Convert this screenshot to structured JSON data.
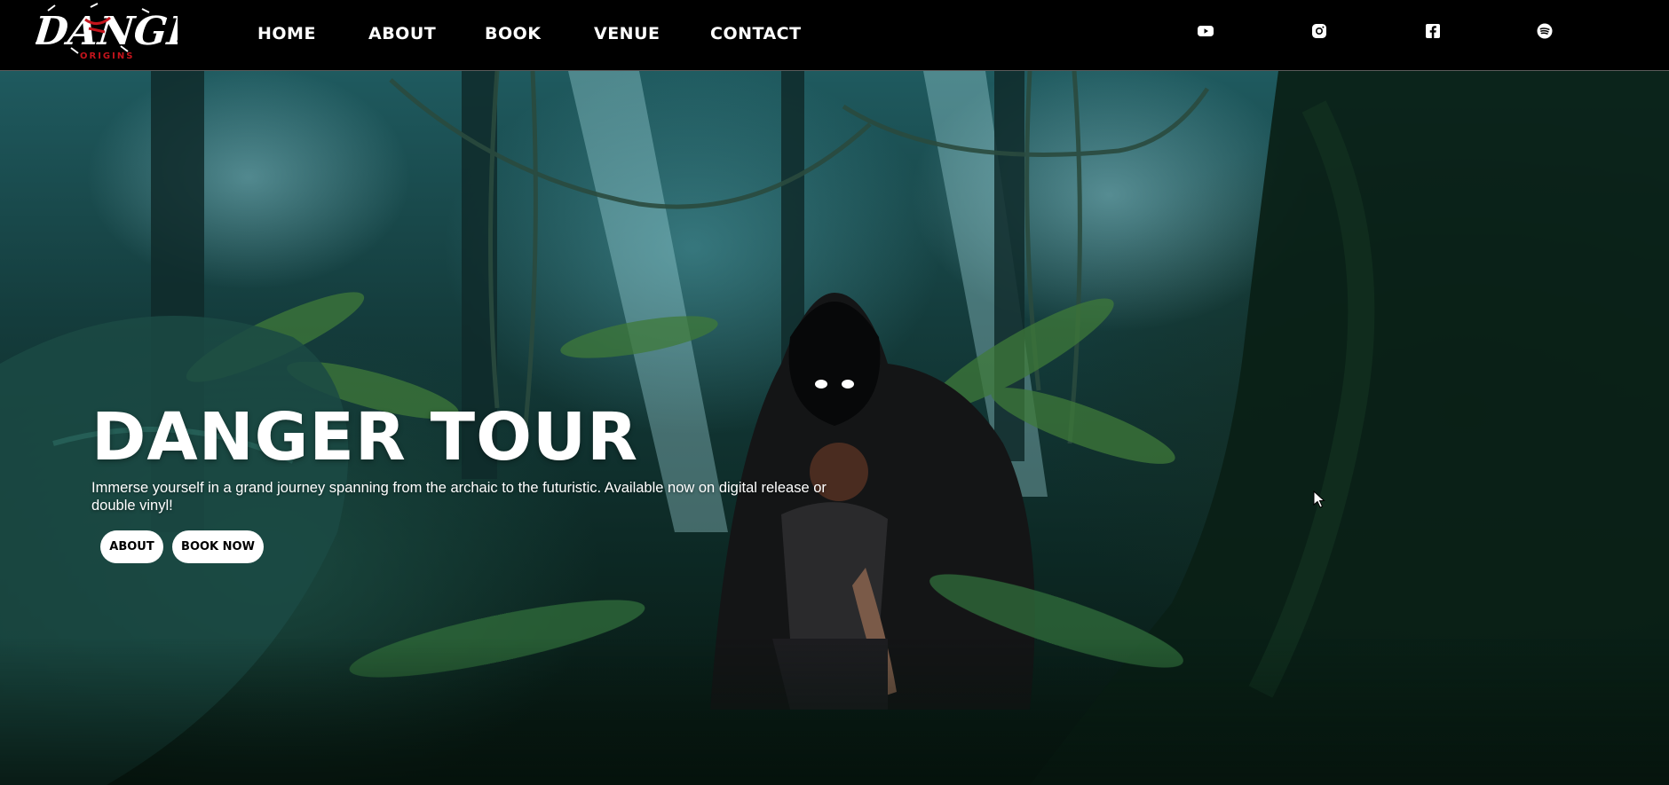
{
  "brand": {
    "logo_text": "DANGER",
    "logo_subtext": "ORIGINS"
  },
  "nav": {
    "items": [
      {
        "label": "HOME"
      },
      {
        "label": "ABOUT"
      },
      {
        "label": "BOOK"
      },
      {
        "label": "VENUE"
      },
      {
        "label": "CONTACT"
      }
    ]
  },
  "social": {
    "icons": [
      "youtube-icon",
      "instagram-icon",
      "facebook-icon",
      "spotify-icon"
    ]
  },
  "hero": {
    "title": "DANGER TOUR",
    "description": "Immerse yourself in a grand journey spanning from the archaic to the futuristic. Available now on digital release or double vinyl!",
    "buttons": {
      "about_label": "ABOUT",
      "book_label": "BOOK NOW"
    }
  },
  "colors": {
    "header_bg": "#000000",
    "button_bg": "#ffffff",
    "button_text": "#000000",
    "logo_accent": "#c4141c"
  }
}
